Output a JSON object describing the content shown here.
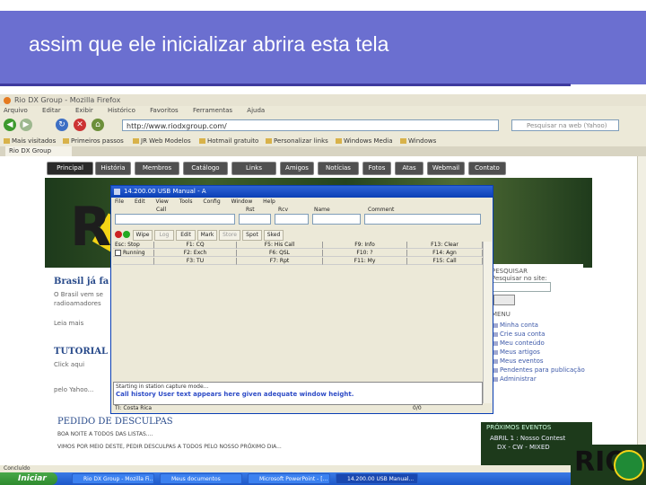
{
  "slide": {
    "title": "assim que ele inicializar abrira esta tela"
  },
  "browser": {
    "window_title": "Rio DX Group - Mozilla Firefox",
    "menu": [
      "Arquivo",
      "Editar",
      "Exibir",
      "Histórico",
      "Favoritos",
      "Ferramentas",
      "Ajuda"
    ],
    "url": "http://www.riodxgroup.com/",
    "search_placeholder": "Pesquisar na web (Yahoo)",
    "bookmarks": [
      "Mais visitados",
      "Primeiros passos",
      "JR Web Modelos",
      "Hotmail gratuito",
      "Personalizar links",
      "Windows Media",
      "Windows"
    ],
    "tab_label": "Rio DX Group",
    "status_text": "Concluído"
  },
  "site": {
    "nav": [
      "Principal",
      "História",
      "Membros",
      "Catálogo",
      "Links",
      "Amigos",
      "Notícias",
      "Fotos",
      "Atas",
      "Webmail",
      "Contato"
    ],
    "left_col": {
      "heading1": "Brasil já fa",
      "heading2": "TUTORIAL",
      "line1": "O Brasil vem se",
      "line2": "radioamadores",
      "line3": "Leia mais",
      "line4": "Click aqui",
      "line5": "pelo Yahoo..."
    },
    "right_panel": {
      "search_heading": "PESQUISAR",
      "search_label": "Pesquisar no site:",
      "menu_heading": "MENU",
      "links": [
        "Minha conta",
        "Crie sua conta",
        "Meu conteúdo",
        "Meus artigos",
        "Meus eventos",
        "Pendentes para publicação",
        "Administrar"
      ],
      "events_heading": "PRÓXIMOS EVENTOS",
      "event1": "ABRIL 1 : Nosso Contest",
      "event2": "DX - CW - MIXED"
    },
    "apology": {
      "title": "PEDIDO DE DESCULPAS",
      "line1": "BOA NOITE A TODOS DAS LISTAS....",
      "line2": "VIMOS POR MEIO DESTE, PEDIR DESCULPAS A TODOS PELO NOSSO PRÓXIMO DIA..."
    }
  },
  "dialog": {
    "title": "14.200.00 USB Manual - A",
    "menu": [
      "File",
      "Edit",
      "View",
      "Tools",
      "Config",
      "Window",
      "Help"
    ],
    "field_labels": [
      "Call",
      "Rst",
      "Rcv",
      "Name",
      "Comment"
    ],
    "toolbar": [
      "Wipe",
      "Log",
      "Edit",
      "Mark",
      "Store",
      "Spot",
      "Sked"
    ],
    "rows": [
      {
        "label": "Esc: Stop",
        "c1": "F1: CQ",
        "c2": "F5: His Call",
        "c3": "F9: Info",
        "c4": "F13: Clear"
      },
      {
        "label": "Running",
        "c1": "F2: Exch",
        "c2": "F6: QSL",
        "c3": "F10: ?",
        "c4": "F14: Agn"
      },
      {
        "label": "",
        "c1": "F3: TU",
        "c2": "F7: Rpt",
        "c3": "F11: My",
        "c4": "F15: Call"
      }
    ],
    "log_header": "Starting in station capture mode...",
    "log_message": "Call history User text appears here given adequate window height.",
    "status": {
      "left": "TI: Costa Rica",
      "right": "0/0"
    }
  },
  "taskbar": {
    "start_label": "Iniciar",
    "tasks": [
      "Rio DX Group - Mozilla Fi...",
      "Meus documentos",
      "Microsoft PowerPoint - [...",
      "14.200.00 USB Manual..."
    ]
  }
}
